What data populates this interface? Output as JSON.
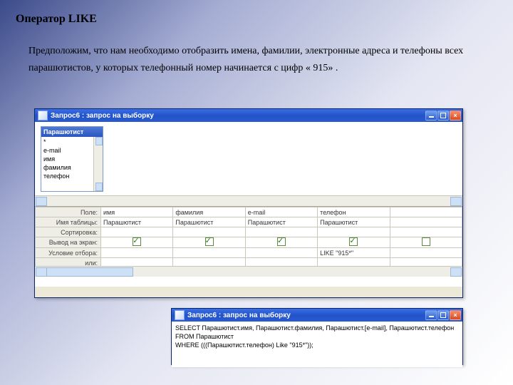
{
  "heading": "Оператор LIKE",
  "description": "Предположим, что нам необходимо отобразить имена, фамилии, электронные адреса и телефоны всех парашютистов, у которых телефонный номер начинается с цифр « 915» .",
  "design_window": {
    "title": "Запрос6 : запрос на выборку",
    "table": {
      "name": "Парашютист",
      "fields": [
        "*",
        "e-mail",
        "имя",
        "фамилия",
        "телефон"
      ]
    },
    "row_labels": {
      "field": "Поле:",
      "table": "Имя таблицы:",
      "sort": "Сортировка:",
      "show": "Вывод на экран:",
      "criteria": "Условие отбора:",
      "or": "или:"
    },
    "columns": [
      {
        "field": "имя",
        "table": "Парашютист",
        "show": true,
        "criteria": ""
      },
      {
        "field": "фамилия",
        "table": "Парашютист",
        "show": true,
        "criteria": ""
      },
      {
        "field": "e-mail",
        "table": "Парашютист",
        "show": true,
        "criteria": ""
      },
      {
        "field": "телефон",
        "table": "Парашютист",
        "show": true,
        "criteria": "LIKE \"915*\""
      },
      {
        "field": "",
        "table": "",
        "show": false,
        "criteria": ""
      }
    ]
  },
  "sql_window": {
    "title": "Запрос6 : запрос на выборку",
    "sql_lines": [
      "SELECT Парашютист.имя, Парашютист.фамилия, Парашютист.[e-mail], Парашютист.телефон",
      "FROM Парашютист",
      "WHERE (((Парашютист.телефон) Like \"915*\"));"
    ]
  }
}
